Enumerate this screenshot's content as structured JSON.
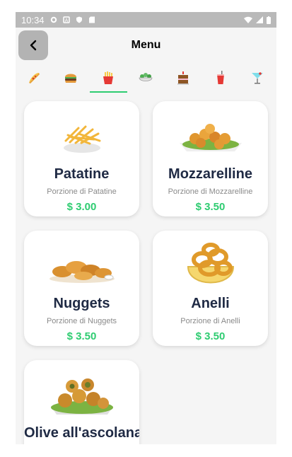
{
  "status_bar": {
    "time": "10:34"
  },
  "header": {
    "title": "Menu"
  },
  "categories": [
    {
      "icon": "pizza-icon"
    },
    {
      "icon": "burger-icon"
    },
    {
      "icon": "fries-icon",
      "selected": true
    },
    {
      "icon": "salad-icon"
    },
    {
      "icon": "cake-icon"
    },
    {
      "icon": "soda-icon"
    },
    {
      "icon": "cocktail-icon"
    }
  ],
  "products": [
    {
      "name": "Patatine",
      "description": "Porzione di Patatine",
      "price": "$ 3.00"
    },
    {
      "name": "Mozzarelline",
      "description": "Porzione di Mozzarelline",
      "price": "$ 3.50"
    },
    {
      "name": "Nuggets",
      "description": "Porzione di Nuggets",
      "price": "$ 3.50"
    },
    {
      "name": "Anelli",
      "description": "Porzione di Anelli",
      "price": "$ 3.50"
    },
    {
      "name": "Olive all'ascolana"
    }
  ],
  "colors": {
    "accent": "#2ecc71",
    "title": "#1f2a44",
    "statusbar": "#b9b9b9"
  }
}
